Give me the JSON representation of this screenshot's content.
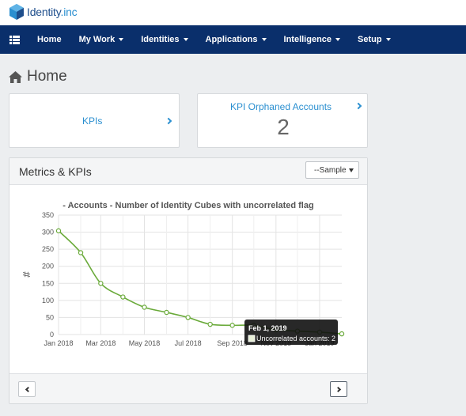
{
  "brand": {
    "name": "Identity",
    "suffix": ".inc"
  },
  "nav": {
    "items": [
      {
        "label": "Home",
        "dropdown": false
      },
      {
        "label": "My Work",
        "dropdown": true
      },
      {
        "label": "Identities",
        "dropdown": true
      },
      {
        "label": "Applications",
        "dropdown": true
      },
      {
        "label": "Intelligence",
        "dropdown": true
      },
      {
        "label": "Setup",
        "dropdown": true
      }
    ]
  },
  "page": {
    "title": "Home"
  },
  "cards": {
    "kpis": {
      "label": "KPIs"
    },
    "orphaned": {
      "label": "KPI Orphaned Accounts",
      "value": "2"
    }
  },
  "panel": {
    "title": "Metrics & KPIs",
    "select_value": "--Sample"
  },
  "colors": {
    "navbar": "#0a2f6b",
    "accent": "#2a8fd0",
    "series": "#6aaa3a"
  },
  "chart_data": {
    "type": "line",
    "title": "- Accounts - Number of Identity Cubes with uncorrelated flag",
    "ylabel": "#",
    "xlabel": "",
    "ylim": [
      0,
      350
    ],
    "yticks": [
      "350",
      "300",
      "250",
      "200",
      "150",
      "100",
      "50",
      "0"
    ],
    "xticks": [
      "Jan 2018",
      "Mar 2018",
      "May 2018",
      "Jul 2018",
      "Sep 2018",
      "Nov 2018",
      "Jan 2019"
    ],
    "grid": true,
    "series": [
      {
        "x": [
          "2018-01-01",
          "2018-02-01",
          "2018-03-01",
          "2018-04-01",
          "2018-05-01",
          "2018-06-01",
          "2018-07-01",
          "2018-08-01",
          "2018-09-01",
          "2018-10-01",
          "2018-11-01",
          "2018-12-01",
          "2019-01-01",
          "2019-02-01"
        ],
        "values": [
          304,
          240,
          150,
          110,
          80,
          65,
          50,
          30,
          27,
          27,
          14,
          10,
          7,
          2
        ]
      }
    ],
    "tooltip": {
      "title": "Feb 1, 2019",
      "text": "Uncorrelated accounts: 2"
    }
  }
}
